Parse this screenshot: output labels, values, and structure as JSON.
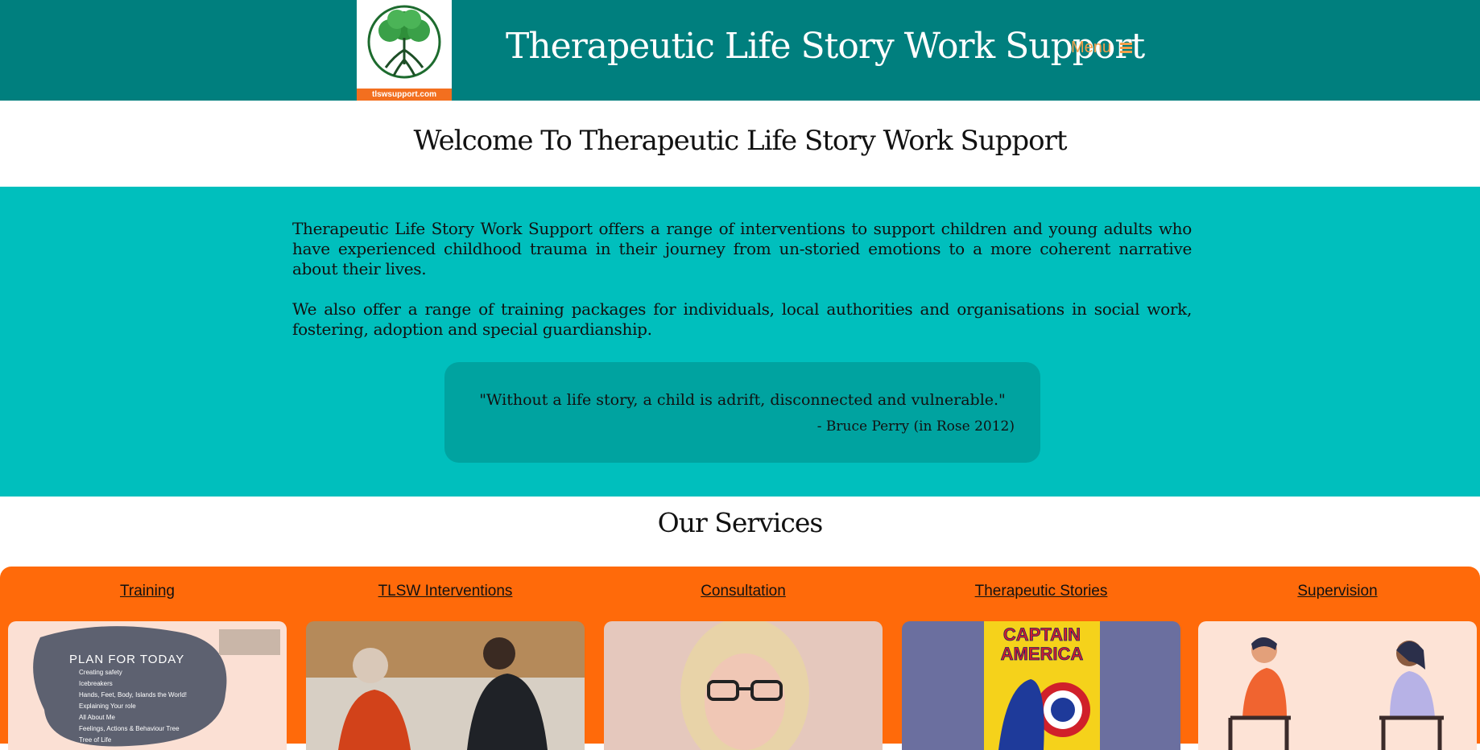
{
  "header": {
    "logo_text": "tlswsupport.com",
    "title": "Therapeutic Life Story Work Support",
    "menu_label": "Menu"
  },
  "welcome": {
    "heading": "Welcome To Therapeutic Life Story Work Support"
  },
  "intro": {
    "paragraphs": [
      "Therapeutic Life Story Work Support offers a range of interventions to support children and young adults who have experienced childhood trauma in their journey from un-storied emotions to a more coherent narrative about their lives.",
      "We also offer a range of training packages for individuals, local authorities and organisations in social work, fostering, adoption and special guardianship."
    ],
    "quote": "\"Without a life story, a child is adrift, disconnected and vulnerable.\"",
    "quote_author": "- Bruce Perry (in Rose 2012)"
  },
  "services": {
    "heading": "Our Services",
    "items": [
      {
        "label": "Training",
        "image_text": {
          "title": "PLAN FOR TODAY",
          "lines": [
            "Creating safety",
            "Icebreakers",
            "Hands, Feet, Body, Islands the World!",
            "Explaining Your role",
            "All About Me",
            "Feelings, Actions & Behaviour Tree",
            "Tree of Life"
          ]
        }
      },
      {
        "label": "TLSW Interventions"
      },
      {
        "label": "Consultation"
      },
      {
        "label": "Therapeutic Stories",
        "image_text": {
          "title_line1": "CAPTAIN",
          "title_line2": "AMERICA"
        }
      },
      {
        "label": "Supervision"
      }
    ]
  },
  "colors": {
    "header_bg": "#007f7e",
    "intro_bg": "#00bfbd",
    "quote_bg": "#00a3a0",
    "services_bg": "#ff6a0a",
    "menu_accent": "#f5a04a"
  }
}
